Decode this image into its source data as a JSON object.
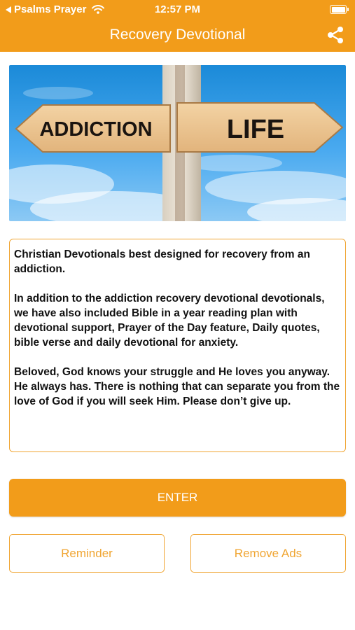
{
  "status_bar": {
    "back_app": "Psalms Prayer",
    "time": "12:57 PM",
    "icons": [
      "back-arrow-icon",
      "wifi-icon",
      "battery-icon"
    ]
  },
  "nav": {
    "title": "Recovery Devotional",
    "share_icon": "share-icon"
  },
  "hero": {
    "sign_left": "ADDICTION",
    "sign_right": "LIFE"
  },
  "description": {
    "p1": "Christian Devotionals best designed for recovery from an addiction.",
    "p2": "In addition to the addiction recovery devotional devotionals, we have also included Bible in a year reading plan with devotional support, Prayer of the Day feature, Daily quotes, bible verse and daily devotional for anxiety.",
    "p3": "Beloved, God knows your struggle and He loves you anyway. He always has. There is nothing that can separate you from the love of God if you will seek Him. Please don’t give up."
  },
  "buttons": {
    "enter": "ENTER",
    "reminder": "Reminder",
    "remove_ads": "Remove Ads"
  },
  "colors": {
    "accent": "#f29c1a",
    "border": "#f0a532"
  }
}
